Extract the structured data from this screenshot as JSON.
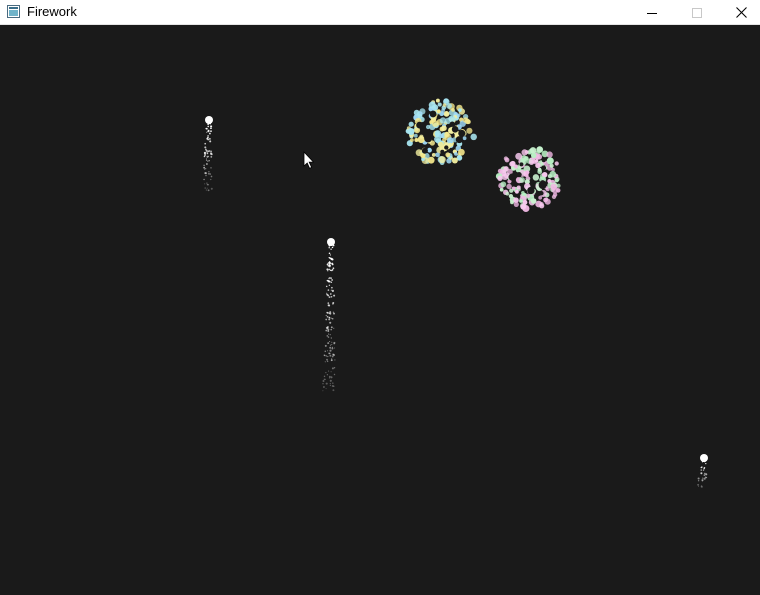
{
  "window": {
    "title": "Firework",
    "icon": "app-window-icon",
    "controls": [
      "minimize-icon",
      "maximize-icon",
      "close-icon"
    ]
  },
  "canvas": {
    "background": "#1a1a1a"
  },
  "colors": {
    "rocket": "#ffffff",
    "burst_a": [
      "#a8e6f0",
      "#f3efa0",
      "#9fd8f5",
      "#f6e98d"
    ],
    "burst_b": [
      "#f0b8e4",
      "#b8f0c4",
      "#f7c8ee",
      "#c9f2cf"
    ]
  }
}
